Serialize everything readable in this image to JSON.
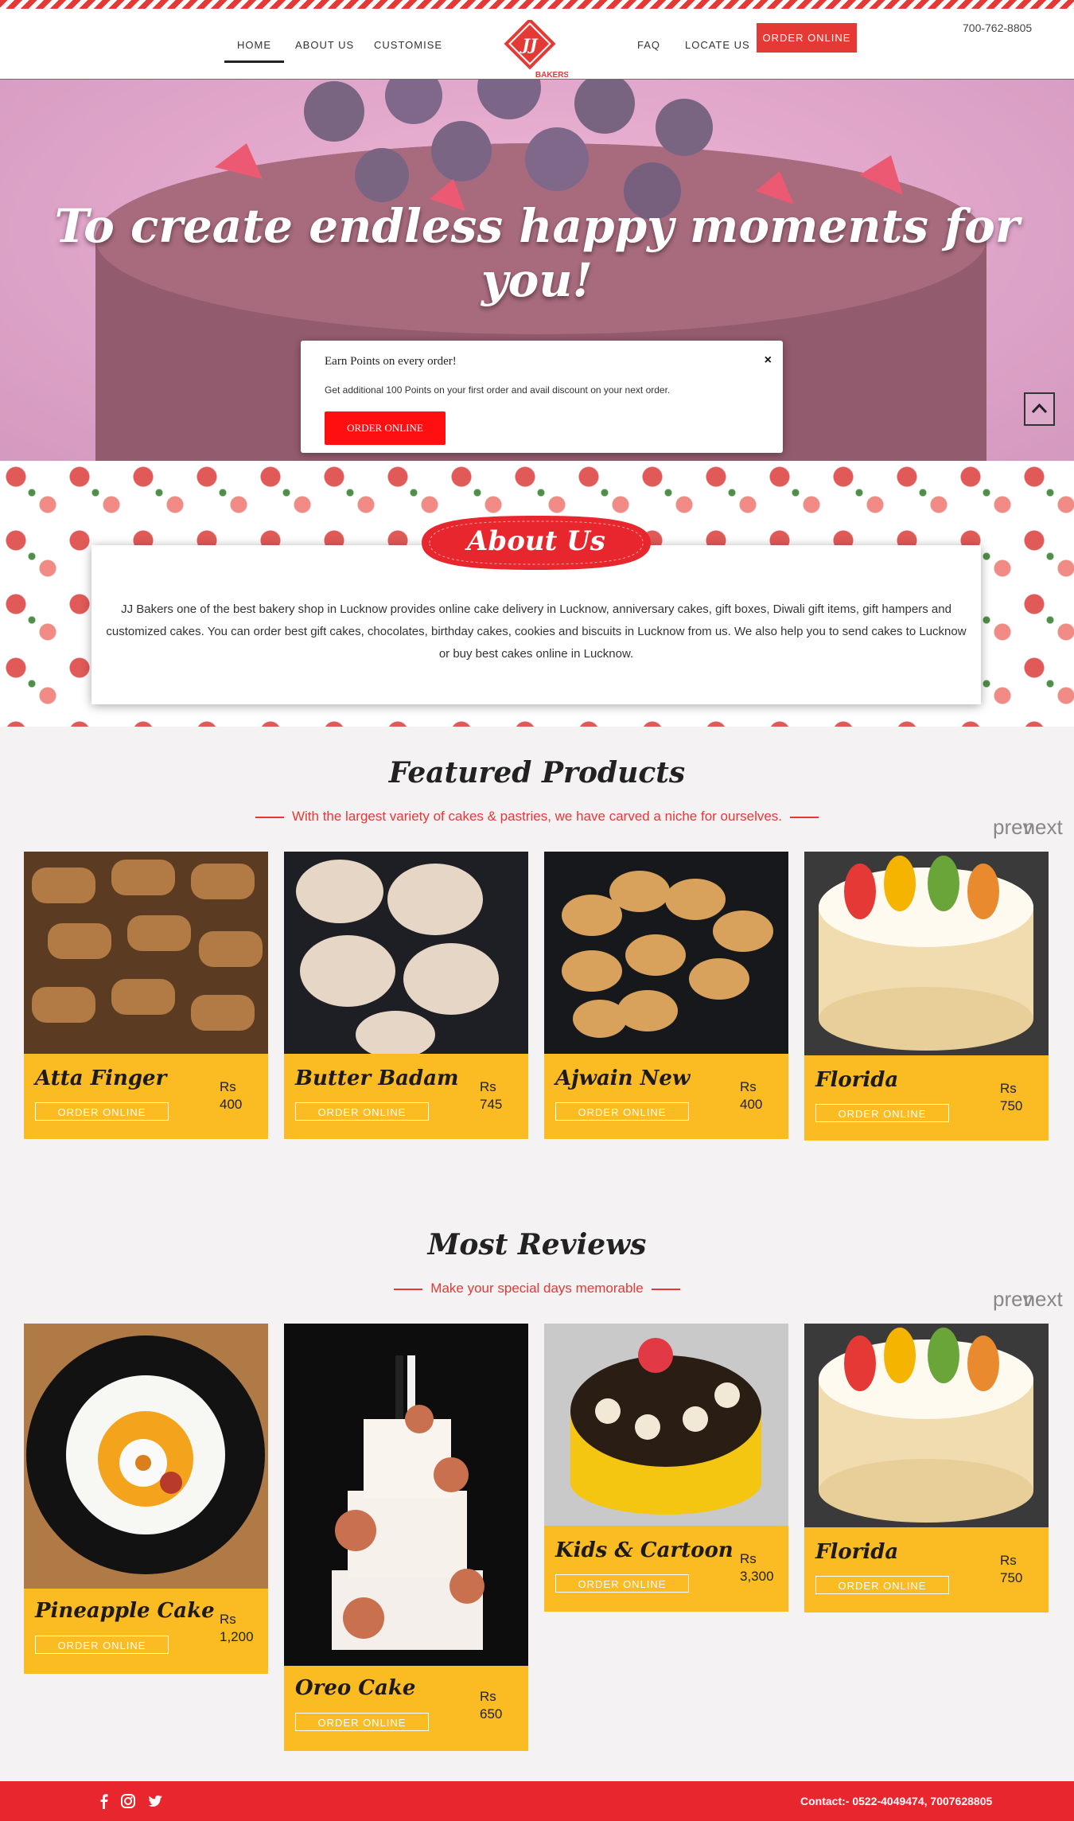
{
  "header": {
    "nav_left": [
      "HOME",
      "ABOUT US",
      "CUSTOMISE"
    ],
    "nav_right": [
      "FAQ",
      "LOCATE US"
    ],
    "order_button": "ORDER ONLINE",
    "phone": "700-762-8805",
    "logo_text": "JJ",
    "logo_sub": "BAKERS"
  },
  "hero": {
    "title": "To create endless happy moments for you!"
  },
  "popup": {
    "title": "Earn Points on every order!",
    "text": "Get additional 100 Points on your first order and avail discount on your next order.",
    "button": "ORDER ONLINE",
    "close": "×"
  },
  "about": {
    "title": "About Us",
    "text": "JJ Bakers one of the best bakery shop in Lucknow provides online cake delivery in Lucknow, anniversary cakes, gift boxes, Diwali gift items, gift hampers and customized cakes. You can order best gift cakes, chocolates, birthday cakes, cookies and biscuits in Lucknow from us. We also help you to send cakes to Lucknow or buy best cakes online in Lucknow."
  },
  "featured": {
    "title": "Featured Products",
    "subtitle": "With the largest variety of cakes & pastries, we have carved a niche for ourselves.",
    "prev": "prev",
    "next": "next",
    "products": [
      {
        "name": "Atta Finger",
        "currency": "Rs",
        "price": "400",
        "button": "ORDER ONLINE"
      },
      {
        "name": "Butter Badam",
        "currency": "Rs",
        "price": "745",
        "button": "ORDER ONLINE"
      },
      {
        "name": "Ajwain New",
        "currency": "Rs",
        "price": "400",
        "button": "ORDER ONLINE"
      },
      {
        "name": "Florida",
        "currency": "Rs",
        "price": "750",
        "button": "ORDER ONLINE"
      }
    ]
  },
  "reviews": {
    "title": "Most Reviews",
    "subtitle": "Make your special days memorable",
    "prev": "prev",
    "next": "next",
    "products": [
      {
        "name": "Pineapple Cake",
        "currency": "Rs",
        "price": "1,200",
        "button": "ORDER ONLINE"
      },
      {
        "name": "Oreo Cake",
        "currency": "Rs",
        "price": "650",
        "button": "ORDER ONLINE"
      },
      {
        "name": "Kids & Cartoon",
        "currency": "Rs",
        "price": "3,300",
        "button": "ORDER ONLINE"
      },
      {
        "name": "Florida",
        "currency": "Rs",
        "price": "750",
        "button": "ORDER ONLINE"
      }
    ]
  },
  "footer": {
    "contact": "Contact:- 0522-4049474, 7007628805",
    "social_icons": [
      "facebook-icon",
      "instagram-icon",
      "twitter-icon"
    ]
  },
  "colors": {
    "brand_red": "#e53935",
    "card_yellow": "#fbbb23"
  }
}
